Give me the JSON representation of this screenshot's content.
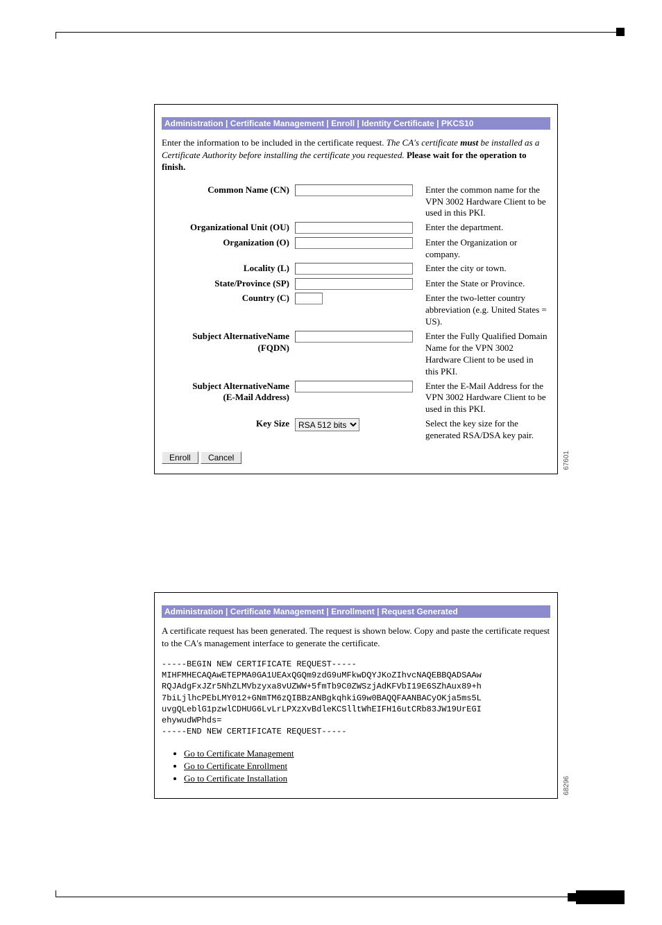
{
  "panel1": {
    "sideId": "67601",
    "titleBar": "Administration | Certificate Management | Enroll | Identity Certificate | PKCS10",
    "intro_pre": "Enter the information to be included in the certificate request. ",
    "intro_mid_a": "The CA's certificate ",
    "intro_mid_must": "must",
    "intro_mid_b": " be installed as a Certificate Authority before installing the certificate you requested.",
    "intro_bold": " Please wait for the operation to finish.",
    "fields": {
      "cn": {
        "label": "Common Name (CN)",
        "help": "Enter the common name for the VPN 3002 Hardware Client to be used in this PKI."
      },
      "ou": {
        "label": "Organizational Unit (OU)",
        "help": "Enter the department."
      },
      "o": {
        "label": "Organization (O)",
        "help": "Enter the Organization or company."
      },
      "l": {
        "label": "Locality (L)",
        "help": "Enter the city or town."
      },
      "sp": {
        "label": "State/Province (SP)",
        "help": "Enter the State or Province."
      },
      "c": {
        "label": "Country (C)",
        "help": "Enter the two-letter country abbreviation (e.g. United States = US)."
      },
      "san_fqdn": {
        "label1": "Subject AlternativeName",
        "label2": "(FQDN)",
        "help": "Enter the Fully Qualified Domain Name for the VPN 3002 Hardware Client to be used in this PKI."
      },
      "san_email": {
        "label1": "Subject AlternativeName",
        "label2": "(E-Mail Address)",
        "help": "Enter the E-Mail Address for the VPN 3002 Hardware Client to be used in this PKI."
      },
      "keysize": {
        "label": "Key Size",
        "value": "RSA 512 bits",
        "help": "Select the key size for the generated RSA/DSA key pair."
      }
    },
    "buttons": {
      "enroll": "Enroll",
      "cancel": "Cancel"
    }
  },
  "panel2": {
    "sideId": "68296",
    "titleBar": "Administration | Certificate Management | Enrollment | Request Generated",
    "intro": "A certificate request has been generated. The request is shown below. Copy and paste the certificate request to the CA's management interface to generate the certificate.",
    "csr": "-----BEGIN NEW CERTIFICATE REQUEST-----\nMIHFMHECAQAwETEPMA0GA1UEAxQGQm9zdG9uMFkwDQYJKoZIhvcNAQEBBQADSAAw\nRQJAdgFxJZr5NhZLMVbzyxa8vUZWW+5fmTb9C0ZWSzjAdKFVbI19E6SZhAux89+h\n7biLjlhcPEbLMY012+GNmTM6zQIBBzANBgkqhkiG9w0BAQQFAANBACyOKja5ms5L\nuvgQLeblG1pzwlCDHUG6LvLrLPXzXvBdleKCSlltWhEIFH16utCRb83JW19UrEGI\nehywudWPhds=\n-----END NEW CERTIFICATE REQUEST-----",
    "links": {
      "mgmt": "Go to Certificate Management",
      "enroll": "Go to Certificate Enrollment",
      "install": "Go to Certificate Installation"
    }
  }
}
